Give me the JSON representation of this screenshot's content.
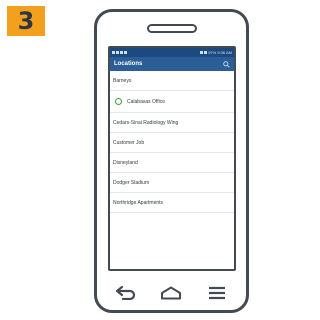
{
  "step": {
    "number": "3"
  },
  "status_bar": {
    "right_text": "97% 9:36 AM"
  },
  "app_bar": {
    "title": "Locations",
    "search_icon": "search-icon"
  },
  "locations": [
    {
      "label": "Barneys",
      "selected": false
    },
    {
      "label": "Calabasas Office",
      "selected": true
    },
    {
      "label": "Cedars-Sinai Radiology Wing",
      "selected": false
    },
    {
      "label": "Customer Job",
      "selected": false
    },
    {
      "label": "Disneyland",
      "selected": false
    },
    {
      "label": "Dodger Stadium",
      "selected": false
    },
    {
      "label": "Northridge Apartments",
      "selected": false
    }
  ],
  "nav": {
    "back_icon": "back-arrow-icon",
    "home_icon": "home-icon",
    "menu_icon": "menu-icon"
  },
  "colors": {
    "badge": "#f3a01e",
    "status_bar": "#1c4a80",
    "app_bar": "#2b5d97",
    "selected_circle": "#3aa63a"
  }
}
